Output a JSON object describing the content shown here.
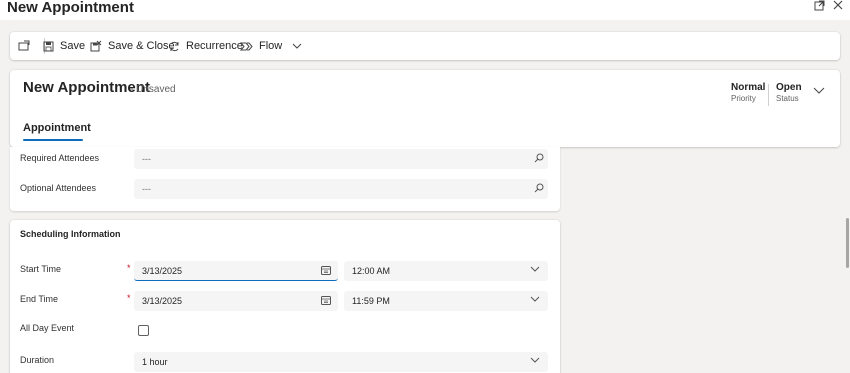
{
  "window": {
    "title": "New Appointment"
  },
  "commandbar": {
    "save_label": "Save",
    "save_close_label": "Save & Close",
    "recurrence_label": "Recurrence",
    "flow_label": "Flow"
  },
  "header": {
    "record_title": "New Appointment",
    "record_state": "- Unsaved",
    "priority_value": "Normal",
    "priority_label": "Priority",
    "status_value": "Open",
    "status_label": "Status",
    "tab_label": "Appointment"
  },
  "attendees": {
    "required_label": "Required Attendees",
    "required_value": "---",
    "optional_label": "Optional Attendees",
    "optional_value": "---"
  },
  "scheduling": {
    "section_title": "Scheduling Information",
    "start_label": "Start Time",
    "start_date": "3/13/2025",
    "start_time": "12:00 AM",
    "end_label": "End Time",
    "end_date": "3/13/2025",
    "end_time": "11:59 PM",
    "all_day_label": "All Day Event",
    "duration_label": "Duration",
    "duration_value": "1 hour",
    "required_marker": "*"
  }
}
